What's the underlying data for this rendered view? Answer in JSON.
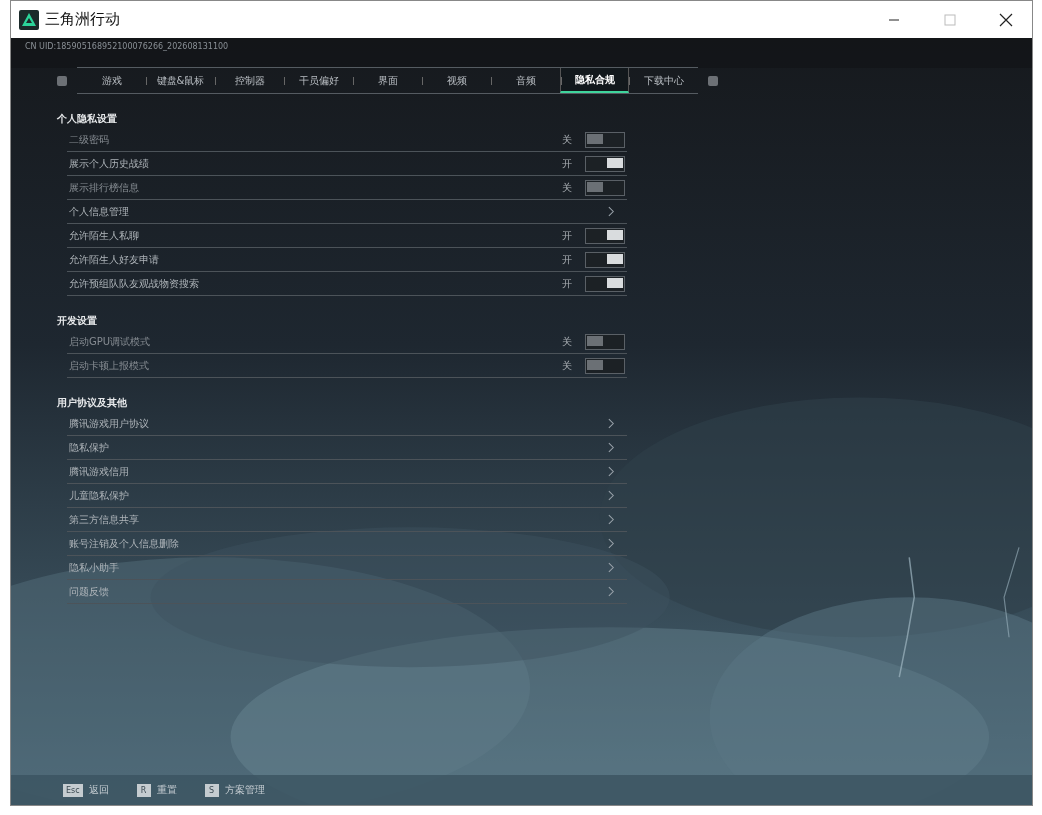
{
  "window": {
    "title": "三角洲行动"
  },
  "uid": "CN UID:185905168952100076266_202608131100",
  "tabs": [
    {
      "label": "游戏",
      "selected": false
    },
    {
      "label": "键盘&鼠标",
      "selected": false
    },
    {
      "label": "控制器",
      "selected": false
    },
    {
      "label": "干员偏好",
      "selected": false
    },
    {
      "label": "界面",
      "selected": false
    },
    {
      "label": "视频",
      "selected": false
    },
    {
      "label": "音频",
      "selected": false
    },
    {
      "label": "隐私合规",
      "selected": true
    },
    {
      "label": "下载中心",
      "selected": false
    }
  ],
  "sections": [
    {
      "title": "个人隐私设置",
      "rows": [
        {
          "kind": "toggle",
          "label": "二级密码",
          "state": "关",
          "on": false
        },
        {
          "kind": "toggle",
          "label": "展示个人历史战绩",
          "state": "开",
          "on": true
        },
        {
          "kind": "toggle",
          "label": "展示排行榜信息",
          "state": "关",
          "on": false
        },
        {
          "kind": "link",
          "label": "个人信息管理"
        },
        {
          "kind": "toggle",
          "label": "允许陌生人私聊",
          "state": "开",
          "on": true
        },
        {
          "kind": "toggle",
          "label": "允许陌生人好友申请",
          "state": "开",
          "on": true
        },
        {
          "kind": "toggle",
          "label": "允许预组队队友观战物资搜索",
          "state": "开",
          "on": true
        }
      ]
    },
    {
      "title": "开发设置",
      "rows": [
        {
          "kind": "toggle",
          "label": "启动GPU调试模式",
          "state": "关",
          "on": false
        },
        {
          "kind": "toggle",
          "label": "启动卡顿上报模式",
          "state": "关",
          "on": false
        }
      ]
    },
    {
      "title": "用户协议及其他",
      "rows": [
        {
          "kind": "link",
          "label": "腾讯游戏用户协议"
        },
        {
          "kind": "link",
          "label": "隐私保护"
        },
        {
          "kind": "link",
          "label": "腾讯游戏信用"
        },
        {
          "kind": "link",
          "label": "儿童隐私保护"
        },
        {
          "kind": "link",
          "label": "第三方信息共享"
        },
        {
          "kind": "link",
          "label": "账号注销及个人信息删除"
        },
        {
          "kind": "link",
          "label": "隐私小助手"
        },
        {
          "kind": "link",
          "label": "问题反馈"
        }
      ]
    }
  ],
  "footer": [
    {
      "key": "Esc",
      "label": "返回"
    },
    {
      "key": "R",
      "label": "重置"
    },
    {
      "key": "S",
      "label": "方案管理"
    }
  ]
}
